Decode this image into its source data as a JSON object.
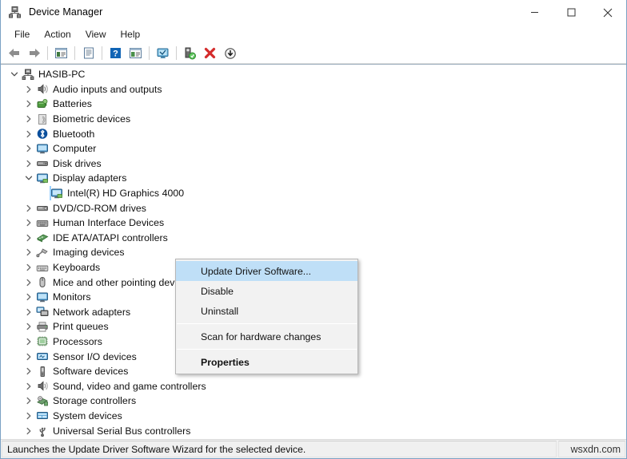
{
  "window": {
    "title": "Device Manager",
    "icon": "device-manager-icon",
    "controls": [
      {
        "name": "minimize-button",
        "glyph": "minimize-icon"
      },
      {
        "name": "maximize-button",
        "glyph": "maximize-icon"
      },
      {
        "name": "close-button",
        "glyph": "close-icon"
      }
    ]
  },
  "menubar": {
    "items": [
      {
        "label": "File"
      },
      {
        "label": "Action"
      },
      {
        "label": "View"
      },
      {
        "label": "Help"
      }
    ]
  },
  "toolbar": {
    "buttons": [
      {
        "name": "back-button",
        "icon": "back-arrow-icon"
      },
      {
        "name": "forward-button",
        "icon": "forward-arrow-icon"
      },
      {
        "name": "show-hide-console-tree-button",
        "icon": "console-tree-icon"
      },
      {
        "name": "properties-button",
        "icon": "properties-page-icon"
      },
      {
        "name": "help-button",
        "icon": "help-question-icon"
      },
      {
        "name": "show-hide-action-pane-button",
        "icon": "action-pane-icon"
      },
      {
        "name": "scan-for-hardware-changes-button",
        "icon": "monitor-scan-icon"
      },
      {
        "name": "update-driver-software-button",
        "icon": "update-driver-icon"
      },
      {
        "name": "uninstall-button",
        "icon": "red-x-icon"
      },
      {
        "name": "disable-device-button",
        "icon": "down-arrow-circle-icon"
      }
    ]
  },
  "tree": {
    "root": {
      "label": "HASIB-PC",
      "icon": "computer-root-icon",
      "expanded": true
    },
    "nodes": [
      {
        "label": "Audio inputs and outputs",
        "icon": "speaker-icon",
        "expanded": false,
        "depth": 1
      },
      {
        "label": "Batteries",
        "icon": "battery-icon",
        "expanded": false,
        "depth": 1
      },
      {
        "label": "Biometric devices",
        "icon": "biometric-icon",
        "expanded": false,
        "depth": 1
      },
      {
        "label": "Bluetooth",
        "icon": "bluetooth-icon",
        "expanded": false,
        "depth": 1
      },
      {
        "label": "Computer",
        "icon": "computer-icon",
        "expanded": false,
        "depth": 1
      },
      {
        "label": "Disk drives",
        "icon": "disk-drive-icon",
        "expanded": false,
        "depth": 1
      },
      {
        "label": "Display adapters",
        "icon": "display-adapter-icon",
        "expanded": true,
        "depth": 1
      },
      {
        "label": "Intel(R) HD Graphics 4000",
        "icon": "display-adapter-icon",
        "depth": 2,
        "selected": true
      },
      {
        "label": "DVD/CD-ROM drives",
        "icon": "optical-drive-icon",
        "expanded": false,
        "depth": 1
      },
      {
        "label": "Human Interface Devices",
        "icon": "hid-icon",
        "expanded": false,
        "depth": 1
      },
      {
        "label": "IDE ATA/ATAPI controllers",
        "icon": "ide-controller-icon",
        "expanded": false,
        "depth": 1
      },
      {
        "label": "Imaging devices",
        "icon": "imaging-device-icon",
        "expanded": false,
        "depth": 1
      },
      {
        "label": "Keyboards",
        "icon": "keyboard-icon",
        "expanded": false,
        "depth": 1
      },
      {
        "label": "Mice and other pointing devices",
        "icon": "mouse-icon",
        "expanded": false,
        "depth": 1
      },
      {
        "label": "Monitors",
        "icon": "monitor-icon",
        "expanded": false,
        "depth": 1
      },
      {
        "label": "Network adapters",
        "icon": "network-adapter-icon",
        "expanded": false,
        "depth": 1
      },
      {
        "label": "Print queues",
        "icon": "printer-icon",
        "expanded": false,
        "depth": 1
      },
      {
        "label": "Processors",
        "icon": "processor-icon",
        "expanded": false,
        "depth": 1
      },
      {
        "label": "Sensor I/O devices",
        "icon": "sensor-icon",
        "expanded": false,
        "depth": 1
      },
      {
        "label": "Software devices",
        "icon": "software-device-icon",
        "expanded": false,
        "depth": 1
      },
      {
        "label": "Sound, video and game controllers",
        "icon": "sound-controller-icon",
        "expanded": false,
        "depth": 1
      },
      {
        "label": "Storage controllers",
        "icon": "storage-controller-icon",
        "expanded": false,
        "depth": 1
      },
      {
        "label": "System devices",
        "icon": "system-device-icon",
        "expanded": false,
        "depth": 1
      },
      {
        "label": "Universal Serial Bus controllers",
        "icon": "usb-controller-icon",
        "expanded": false,
        "depth": 1
      }
    ]
  },
  "context_menu": {
    "items": [
      {
        "label": "Update Driver Software...",
        "highlighted": true,
        "bold": false
      },
      {
        "label": "Disable",
        "highlighted": false,
        "bold": false
      },
      {
        "label": "Uninstall",
        "highlighted": false,
        "bold": false
      },
      {
        "separator": true
      },
      {
        "label": "Scan for hardware changes",
        "highlighted": false,
        "bold": false
      },
      {
        "separator": true
      },
      {
        "label": "Properties",
        "highlighted": false,
        "bold": true
      }
    ]
  },
  "statusbar": {
    "message": "Launches the Update Driver Software Wizard for the selected device.",
    "right_text": "wsxdn.com"
  },
  "colors": {
    "selection_fill": "#cce8ff",
    "selection_border": "#99d1ff",
    "menu_highlight": "#bfdff7",
    "window_border": "#7ba1c4",
    "accent_red": "#d42b2b",
    "accent_green": "#4caf50"
  }
}
